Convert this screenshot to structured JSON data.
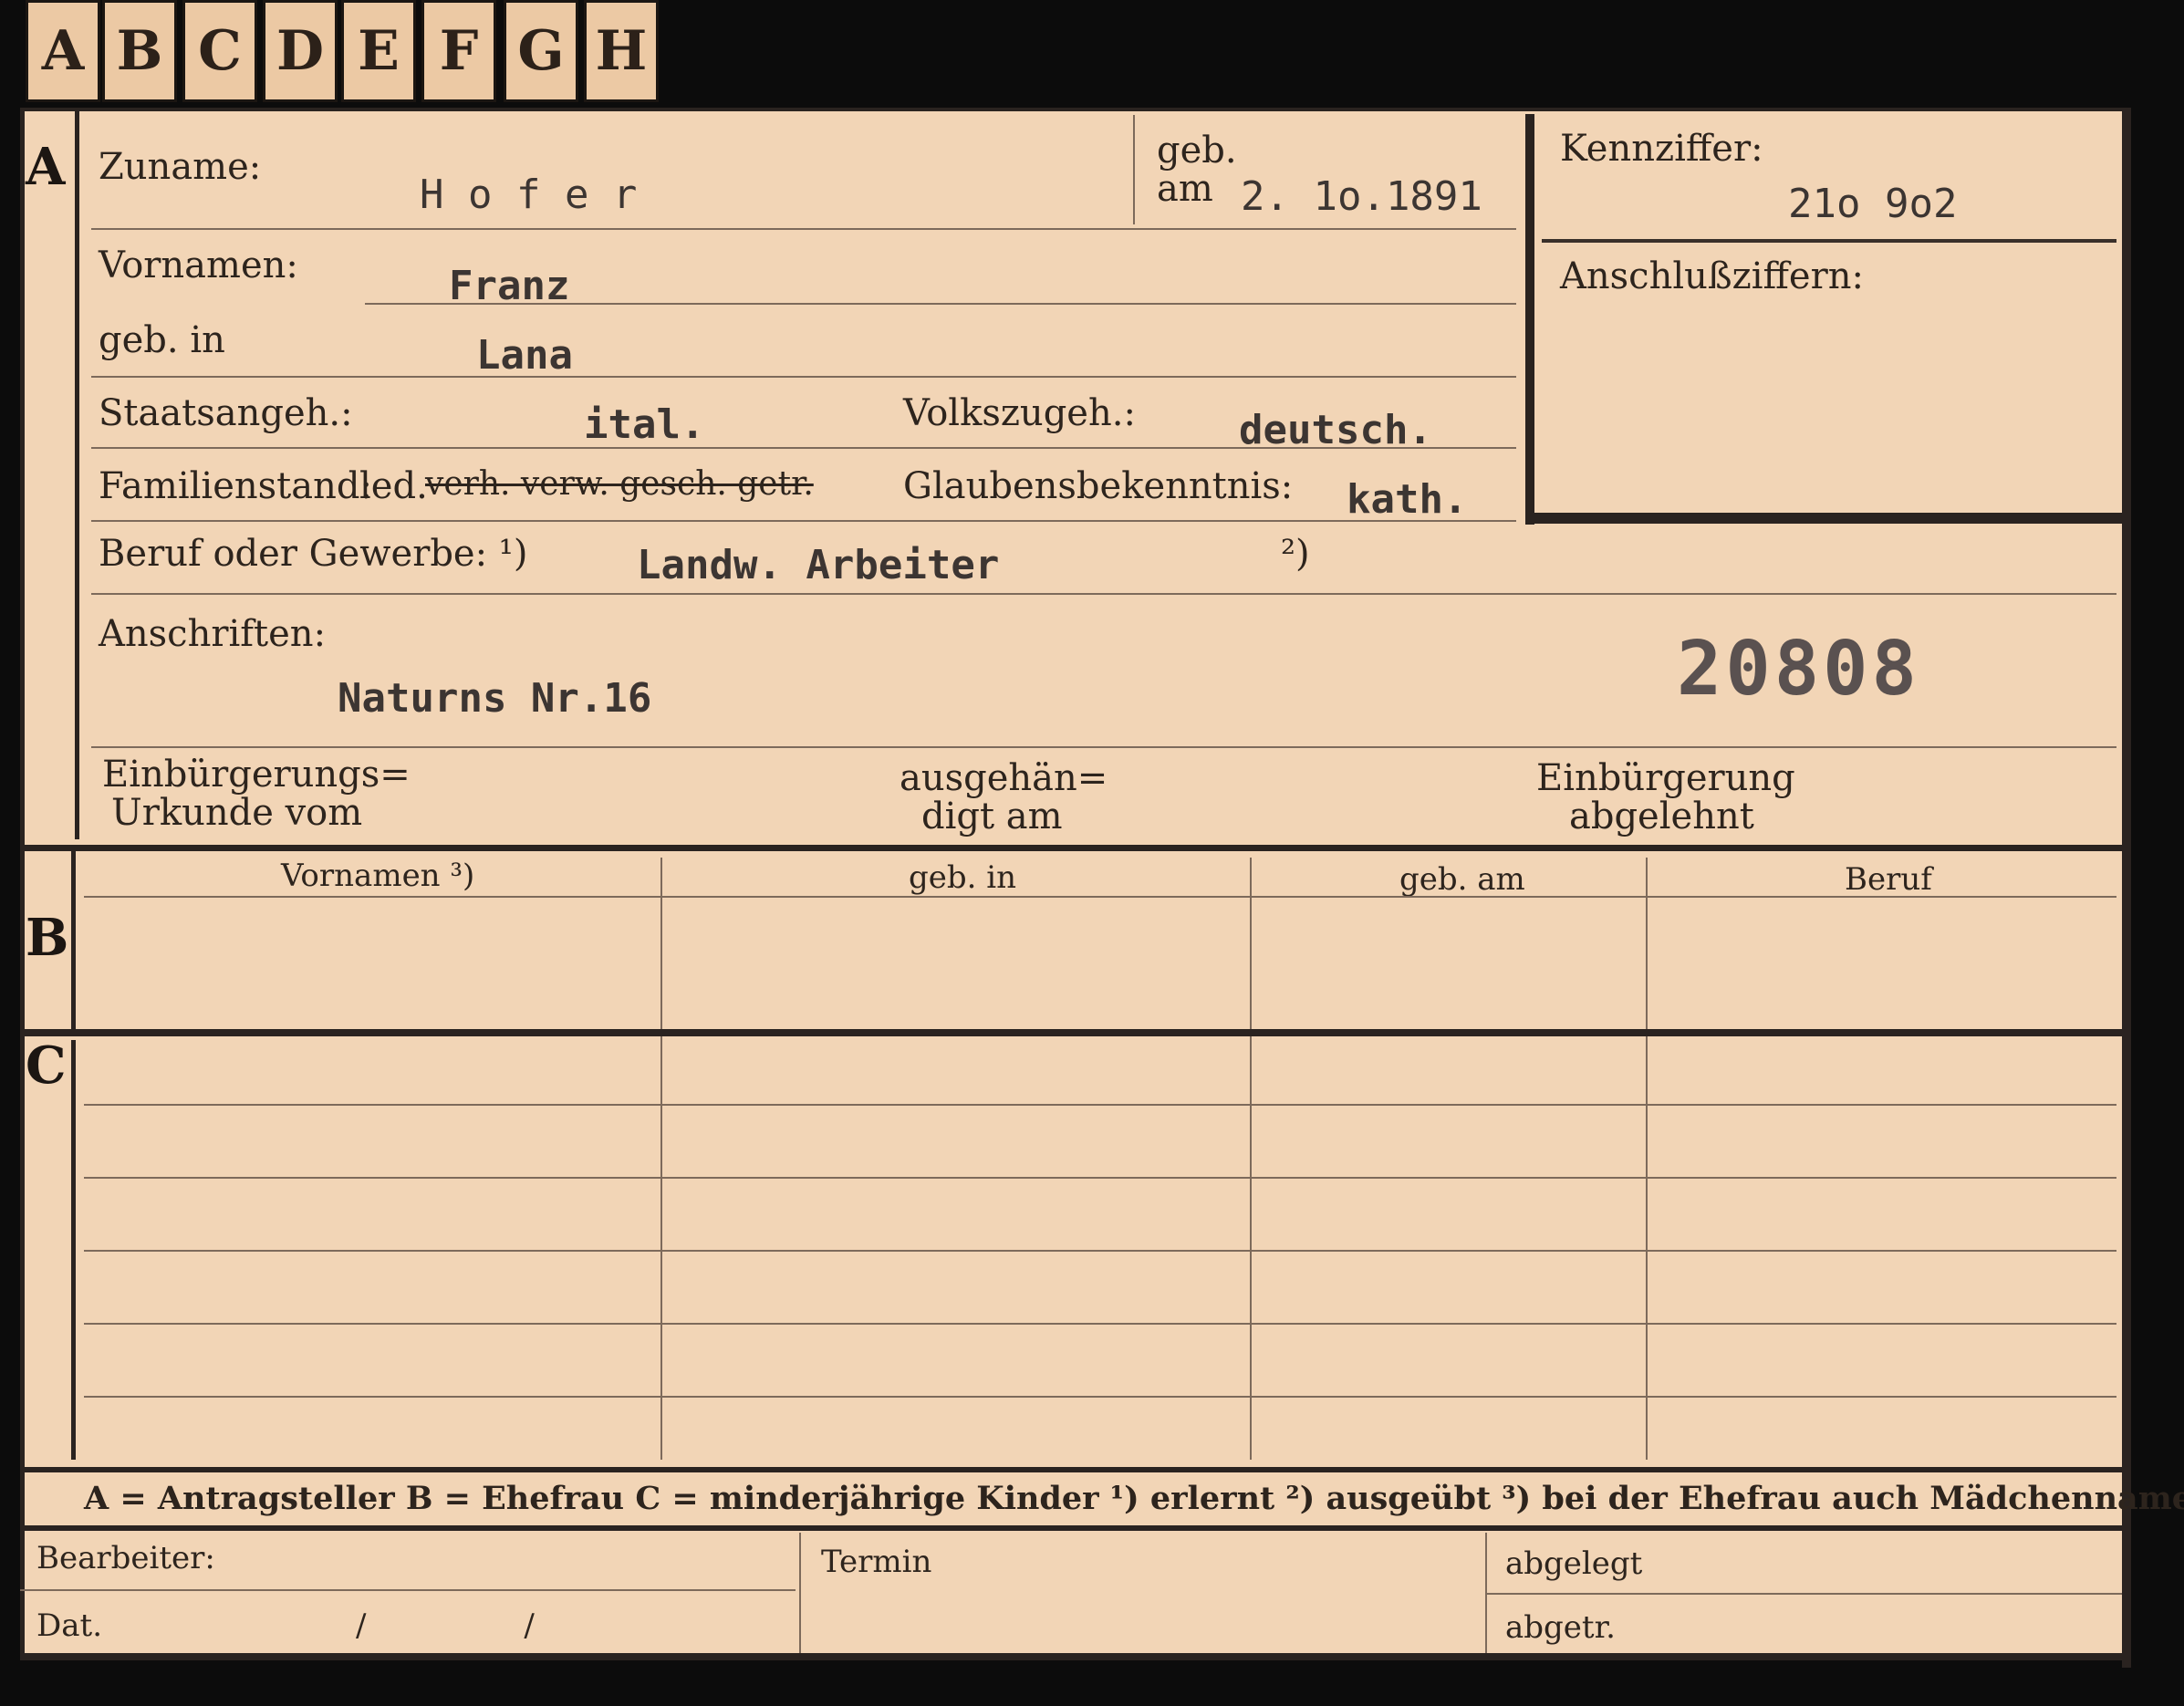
{
  "tabs": [
    "A",
    "B",
    "C",
    "D",
    "E",
    "F",
    "G",
    "H"
  ],
  "section_letters": {
    "a": "A",
    "b": "B",
    "c": "C"
  },
  "labels": {
    "zuname": "Zuname:",
    "geb": "geb.",
    "am": "am",
    "kennziffer": "Kennziffer:",
    "anschlussziffern": "Anschlußziffern:",
    "vornamen": "Vornamen:",
    "geb_in": "geb. in",
    "staatsangeh": "Staatsangeh.:",
    "volkszugeh": "Volkszugeh.:",
    "familienstand": "Familienstand:",
    "fam_led": "led.",
    "fam_struck": "verh. verw. gesch. getr.",
    "glaubensbekenntnis": "Glaubensbekenntnis:",
    "beruf": "Beruf oder Gewerbe: ¹)",
    "beruf_note2": "²)",
    "anschriften": "Anschriften:",
    "einb_urkunde_1": "Einbürgerungs=",
    "einb_urkunde_2": "Urkunde vom",
    "ausgehaendigt_1": "ausgehän=",
    "ausgehaendigt_2": "digt am",
    "einb_abgelehnt_1": "Einbürgerung",
    "einb_abgelehnt_2": "abgelehnt",
    "col_vornamen": "Vornamen ³)",
    "col_geb_in": "geb. in",
    "col_geb_am": "geb. am",
    "col_beruf": "Beruf",
    "legend": "A = Antragsteller   B = Ehefrau   C = minderjährige Kinder   ¹) erlernt   ²) ausgeübt   ³) bei der Ehefrau auch Mädchenname",
    "bearbeiter": "Bearbeiter:",
    "dat": "Dat.",
    "termin": "Termin",
    "abgelegt": "abgelegt",
    "abgetr": "abgetr."
  },
  "values": {
    "zuname": "H o f e r",
    "geb_am": "2. 1o.1891",
    "kennziffer": "21o 9o2",
    "vornamen": "Franz",
    "geb_in": "Lana",
    "staatsangeh": "ital.",
    "volkszugeh": "deutsch.",
    "glaubensbekenntnis": "kath.",
    "beruf": "Landw. Arbeiter",
    "anschrift": "Naturns Nr.16",
    "stamp_number": "20808",
    "dat_slashes": "/                /"
  }
}
